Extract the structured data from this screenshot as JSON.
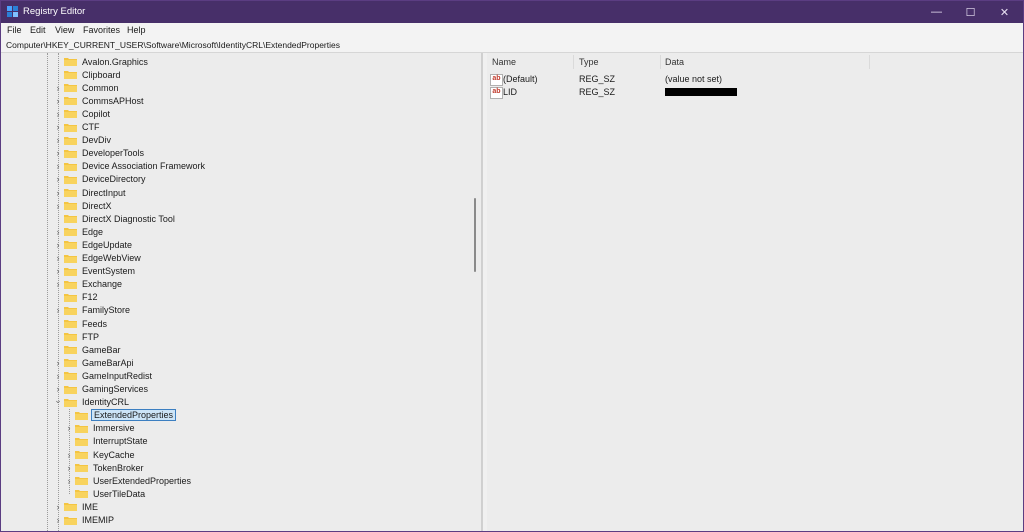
{
  "window": {
    "title": "Registry Editor",
    "controls": {
      "minimize": "—",
      "maximize": "☐",
      "close": "✕"
    }
  },
  "menu": [
    "File",
    "Edit",
    "View",
    "Favorites",
    "Help"
  ],
  "address": "Computer\\HKEY_CURRENT_USER\\Software\\Microsoft\\IdentityCRL\\ExtendedProperties",
  "tree": {
    "items": [
      {
        "label": "Avalon.Graphics",
        "depth": 1,
        "expand": ""
      },
      {
        "label": "Clipboard",
        "depth": 1,
        "expand": ""
      },
      {
        "label": "Common",
        "depth": 1,
        "expand": ">"
      },
      {
        "label": "CommsAPHost",
        "depth": 1,
        "expand": ">"
      },
      {
        "label": "Copilot",
        "depth": 1,
        "expand": ">"
      },
      {
        "label": "CTF",
        "depth": 1,
        "expand": ">"
      },
      {
        "label": "DevDiv",
        "depth": 1,
        "expand": ">"
      },
      {
        "label": "DeveloperTools",
        "depth": 1,
        "expand": ">"
      },
      {
        "label": "Device Association Framework",
        "depth": 1,
        "expand": ">"
      },
      {
        "label": "DeviceDirectory",
        "depth": 1,
        "expand": ">"
      },
      {
        "label": "DirectInput",
        "depth": 1,
        "expand": ">"
      },
      {
        "label": "DirectX",
        "depth": 1,
        "expand": ">"
      },
      {
        "label": "DirectX Diagnostic Tool",
        "depth": 1,
        "expand": ""
      },
      {
        "label": "Edge",
        "depth": 1,
        "expand": ">"
      },
      {
        "label": "EdgeUpdate",
        "depth": 1,
        "expand": ">"
      },
      {
        "label": "EdgeWebView",
        "depth": 1,
        "expand": ">"
      },
      {
        "label": "EventSystem",
        "depth": 1,
        "expand": ">"
      },
      {
        "label": "Exchange",
        "depth": 1,
        "expand": ">"
      },
      {
        "label": "F12",
        "depth": 1,
        "expand": ""
      },
      {
        "label": "FamilyStore",
        "depth": 1,
        "expand": ">"
      },
      {
        "label": "Feeds",
        "depth": 1,
        "expand": ""
      },
      {
        "label": "FTP",
        "depth": 1,
        "expand": ""
      },
      {
        "label": "GameBar",
        "depth": 1,
        "expand": ""
      },
      {
        "label": "GameBarApi",
        "depth": 1,
        "expand": ">"
      },
      {
        "label": "GameInputRedist",
        "depth": 1,
        "expand": ">"
      },
      {
        "label": "GamingServices",
        "depth": 1,
        "expand": ">"
      },
      {
        "label": "IdentityCRL",
        "depth": 1,
        "expand": "v"
      },
      {
        "label": "ExtendedProperties",
        "depth": 2,
        "expand": "",
        "selected": true
      },
      {
        "label": "Immersive",
        "depth": 2,
        "expand": ">"
      },
      {
        "label": "InterruptState",
        "depth": 2,
        "expand": ""
      },
      {
        "label": "KeyCache",
        "depth": 2,
        "expand": ">"
      },
      {
        "label": "TokenBroker",
        "depth": 2,
        "expand": ">"
      },
      {
        "label": "UserExtendedProperties",
        "depth": 2,
        "expand": ">"
      },
      {
        "label": "UserTileData",
        "depth": 2,
        "expand": ""
      },
      {
        "label": "IME",
        "depth": 1,
        "expand": ">"
      },
      {
        "label": "IMEMIP",
        "depth": 1,
        "expand": ">"
      }
    ]
  },
  "values": {
    "headers": {
      "name": "Name",
      "type": "Type",
      "data": "Data"
    },
    "rows": [
      {
        "icon": "ab",
        "name": "(Default)",
        "type": "REG_SZ",
        "data": "(value not set)"
      },
      {
        "icon": "ab",
        "name": "LID",
        "type": "REG_SZ",
        "data": ""
      }
    ]
  },
  "colors": {
    "titlebar": "#472f69",
    "folder": "#f4c542",
    "selection": "#cce4f7"
  }
}
